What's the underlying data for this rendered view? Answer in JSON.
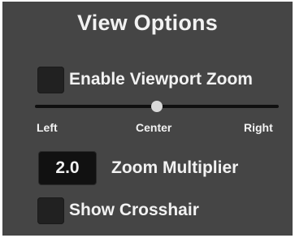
{
  "panel": {
    "title": "View Options",
    "enable_zoom": {
      "label": "Enable Viewport Zoom",
      "checked": false
    },
    "slider": {
      "value": 0.5,
      "labels": {
        "left": "Left",
        "center": "Center",
        "right": "Right"
      }
    },
    "zoom_multiplier": {
      "value": "2.0",
      "label": "Zoom Multiplier"
    },
    "show_crosshair": {
      "label": "Show Crosshair",
      "checked": false
    }
  },
  "colors": {
    "panel_bg": "#454545",
    "text": "#f2f2f2",
    "control_bg": "#212121",
    "track": "#0f0f0f",
    "thumb": "#d9d9d9"
  }
}
